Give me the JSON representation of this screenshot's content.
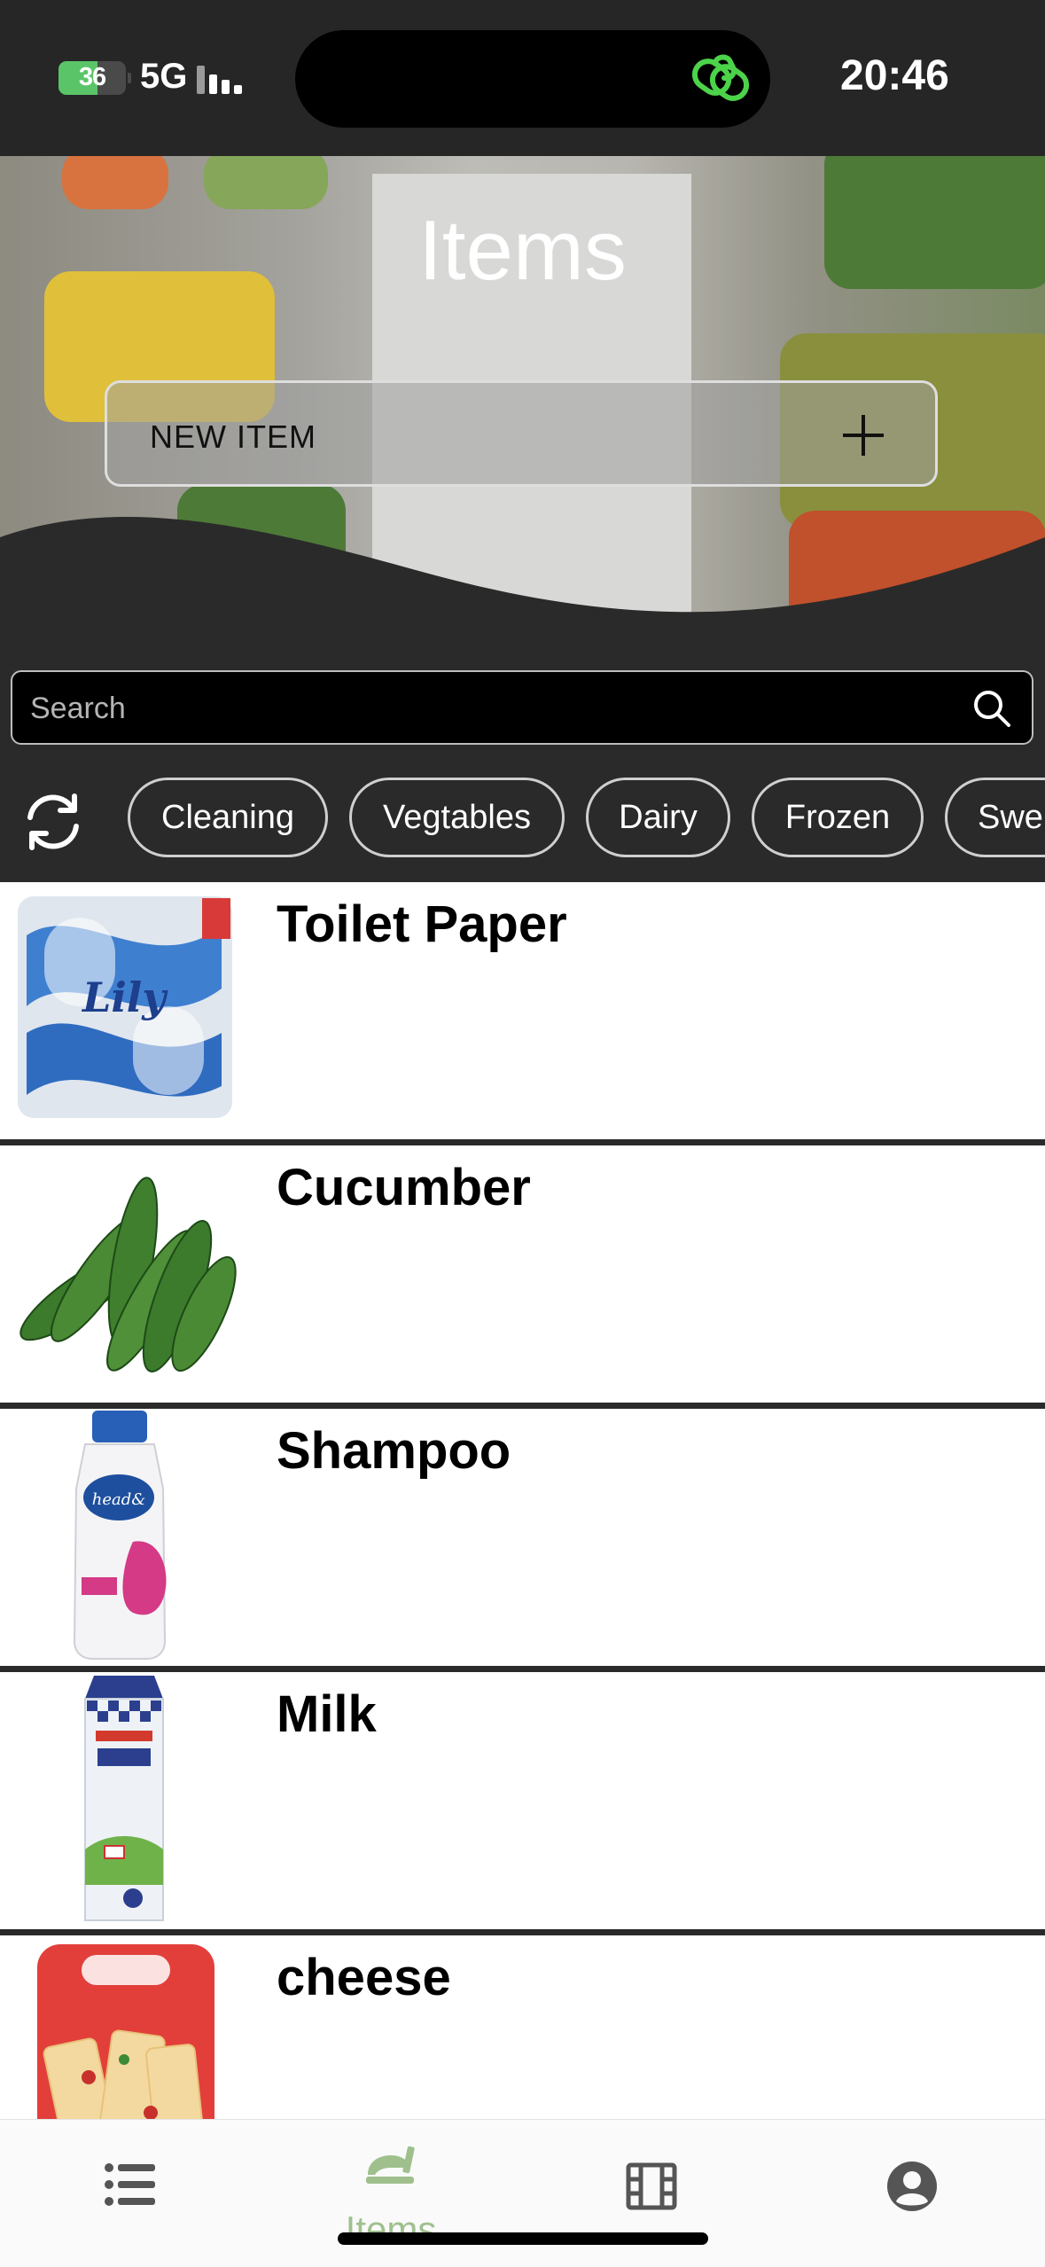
{
  "status_bar": {
    "battery": "36",
    "network": "5G",
    "time": "20:46"
  },
  "header": {
    "title": "Items",
    "new_item_label": "NEW ITEM"
  },
  "search": {
    "placeholder": "Search",
    "value": ""
  },
  "filters": [
    "Cleaning",
    "Vegtables",
    "Dairy",
    "Frozen",
    "Swe"
  ],
  "items": [
    {
      "name": "Toilet Paper"
    },
    {
      "name": "Cucumber"
    },
    {
      "name": "Shampoo"
    },
    {
      "name": "Milk"
    },
    {
      "name": "cheese"
    }
  ],
  "tabbar": {
    "tabs": [
      {
        "icon": "list-icon",
        "label": ""
      },
      {
        "icon": "food-icon",
        "label": "Items",
        "active": true
      },
      {
        "icon": "film-icon",
        "label": ""
      },
      {
        "icon": "profile-icon",
        "label": ""
      }
    ],
    "active_color": "#9fc08d"
  },
  "colors": {
    "accent": "#9fc08d",
    "link_icon": "#4cd34a",
    "battery": "#5ac469"
  }
}
